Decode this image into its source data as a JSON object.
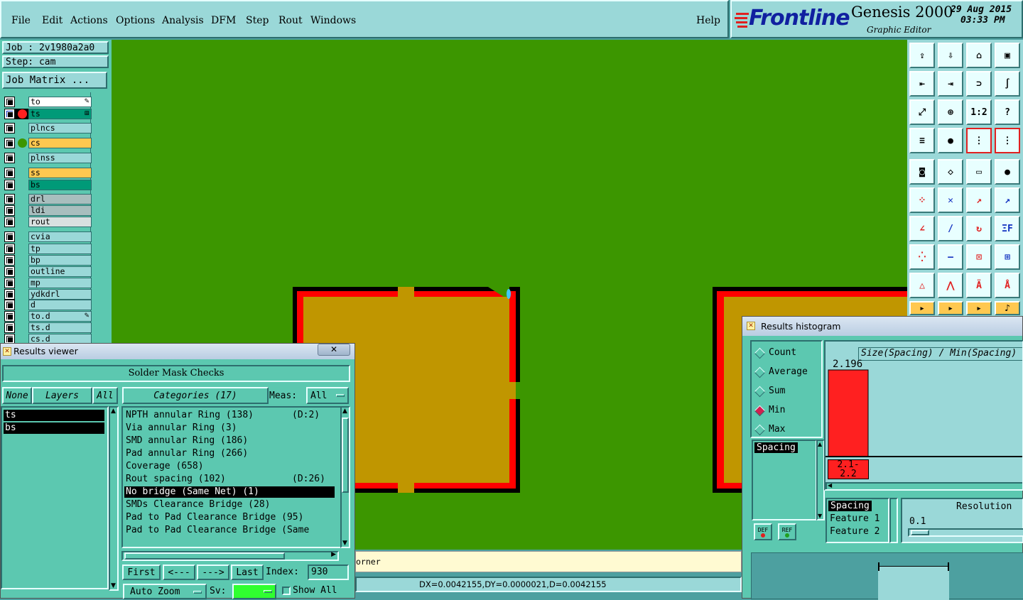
{
  "menu": {
    "items": [
      "File",
      "Edit",
      "Actions",
      "Options",
      "Analysis",
      "DFM",
      "Step",
      "Rout",
      "Windows"
    ],
    "help": "Help"
  },
  "brand": {
    "logo": "Frontline",
    "product": "Genesis 2000",
    "subtitle": "Graphic Editor",
    "date": "29 Aug 2015",
    "time": "03:33 PM"
  },
  "job": {
    "job_label": "Job : 2v1980a2a0",
    "step_label": "Step: cam",
    "matrix_button": "Job Matrix ..."
  },
  "layers": [
    {
      "name": "to",
      "color": "#ffffff",
      "dot": "",
      "marker": "✎"
    },
    {
      "name": "ts",
      "color": "#009a78",
      "dot": "#ff2020",
      "marker": "⊞",
      "selected": true
    },
    {
      "name": "plncs",
      "color": "#9ad8d8",
      "dot": "",
      "marker": ""
    },
    {
      "name": "cs",
      "color": "#ffc850",
      "dot": "#3c9600",
      "marker": ""
    },
    {
      "name": "plnss",
      "color": "#9ad8d8",
      "dot": "",
      "marker": ""
    },
    {
      "name": "ss",
      "color": "#ffc850",
      "dot": "",
      "marker": ""
    },
    {
      "name": "bs",
      "color": "#009a78",
      "dot": "",
      "marker": ""
    },
    {
      "name": "drl",
      "color": "#a8bebe",
      "dot": "",
      "marker": ""
    },
    {
      "name": "ldi",
      "color": "#a8bebe",
      "dot": "",
      "marker": ""
    },
    {
      "name": "rout",
      "color": "#d8e0e0",
      "dot": "",
      "marker": ""
    },
    {
      "name": "cvia",
      "color": "#9ad8d8",
      "dot": "",
      "marker": ""
    },
    {
      "name": "tp",
      "color": "#9ad8d8",
      "dot": "",
      "marker": ""
    },
    {
      "name": "bp",
      "color": "#9ad8d8",
      "dot": "",
      "marker": ""
    },
    {
      "name": "outline",
      "color": "#9ad8d8",
      "dot": "",
      "marker": ""
    },
    {
      "name": "mp",
      "color": "#9ad8d8",
      "dot": "",
      "marker": ""
    },
    {
      "name": "ydkdrl",
      "color": "#9ad8d8",
      "dot": "",
      "marker": ""
    },
    {
      "name": "d",
      "color": "#9ad8d8",
      "dot": "",
      "marker": ""
    },
    {
      "name": "to.d",
      "color": "#9ad8d8",
      "dot": "",
      "marker": "✎"
    },
    {
      "name": "ts.d",
      "color": "#9ad8d8",
      "dot": "",
      "marker": ""
    },
    {
      "name": "cs.d",
      "color": "#9ad8d8",
      "dot": "",
      "marker": ""
    }
  ],
  "results_viewer": {
    "title": "Results viewer",
    "close": "✕",
    "header": "Solder Mask Checks",
    "none_btn": "None",
    "layers_label": "Layers",
    "all_btn": "All",
    "categories_label": "Categories (17)",
    "meas_label": "Meas:",
    "meas_value": "All",
    "layer_items": [
      "ts",
      "bs"
    ],
    "categories": [
      {
        "text": "NPTH annular Ring (138)",
        "extra": "(D:2)"
      },
      {
        "text": "Via annular Ring (3)",
        "extra": ""
      },
      {
        "text": "SMD annular Ring (186)",
        "extra": ""
      },
      {
        "text": "Pad annular Ring (266)",
        "extra": ""
      },
      {
        "text": "Coverage (658)",
        "extra": ""
      },
      {
        "text": "Rout spacing (102)",
        "extra": "(D:26)"
      },
      {
        "text": "No bridge (Same Net) (1)",
        "extra": "",
        "selected": true
      },
      {
        "text": "SMDs Clearance Bridge (28)",
        "extra": ""
      },
      {
        "text": "Pad to Pad Clearance Bridge (95)",
        "extra": ""
      },
      {
        "text": "Pad to Pad Clearance Bridge (Same",
        "extra": ""
      }
    ],
    "first": "First",
    "prev": "<---",
    "next": "--->",
    "last": "Last",
    "index_label": "Index:",
    "index_value": "930",
    "auto_zoom": "Auto Zoom",
    "sv_label": "Sv:",
    "show_all": "Show All"
  },
  "histogram": {
    "title": "Results histogram",
    "options": [
      "Count",
      "Average",
      "Sum",
      "Min",
      "Max"
    ],
    "selected": "Min",
    "heading": "Size(Spacing) / Min(Spacing)",
    "list_item": "Spacing",
    "def_btn": "DEF",
    "ref_btn": "REF",
    "bar_value": "2.196",
    "bar_range": "2.1-\n2.2",
    "attrs": [
      "Spacing",
      "Feature 1",
      "Feature 2"
    ],
    "resolution_label": "Resolution",
    "resolution_value": "0.1",
    "chart_data": {
      "type": "bar",
      "categories": [
        "2.1-2.2"
      ],
      "values": [
        2.196
      ]
    }
  },
  "status": {
    "message": "orner",
    "coords": "DX=0.0042155,DY=0.0000021,D=0.0042155"
  },
  "colors": {
    "panel": "#5cc8b0",
    "light": "#9ad8d8",
    "canvas": "#3c9600",
    "pad": "#c09600",
    "mask_edge": "#ff0000"
  }
}
